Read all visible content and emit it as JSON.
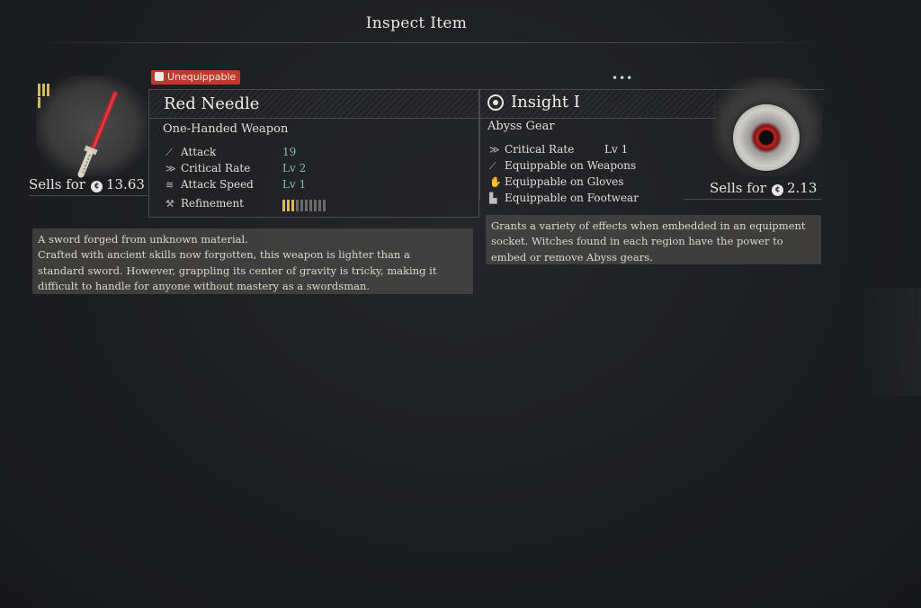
{
  "header": {
    "title": "Inspect Item",
    "pager": "•••"
  },
  "left_item": {
    "tag": "Unequippable",
    "name": "Red Needle",
    "type": "One-Handed Weapon",
    "sells_label": "Sells for",
    "sells_value": "13.63",
    "stats": [
      {
        "icon": "attack-icon",
        "label": "Attack",
        "value": "19"
      },
      {
        "icon": "critical-rate-icon",
        "label": "Critical Rate",
        "value": "Lv 2"
      },
      {
        "icon": "attack-speed-icon",
        "label": "Attack Speed",
        "value": "Lv 1"
      },
      {
        "icon": "refinement-icon",
        "label": "Refinement",
        "value": ""
      }
    ],
    "refinement": {
      "level": 3,
      "max": 10
    },
    "description": [
      "A sword forged from unknown material.",
      "Crafted with ancient skills now forgotten, this weapon is lighter than a",
      "standard sword. However, grappling its center of gravity is tricky, making it",
      "difficult to handle for anyone without mastery as a swordsman."
    ]
  },
  "right_item": {
    "name": "Insight I",
    "type": "Abyss Gear",
    "sells_label": "Sells for",
    "sells_value": "2.13",
    "stats": [
      {
        "icon": "critical-rate-icon",
        "label": "Critical Rate",
        "value": "Lv 1"
      },
      {
        "icon": "weapons-icon",
        "label": "Equippable on Weapons",
        "value": ""
      },
      {
        "icon": "gloves-icon",
        "label": "Equippable on Gloves",
        "value": ""
      },
      {
        "icon": "footwear-icon",
        "label": "Equippable on Footwear",
        "value": ""
      }
    ],
    "description": [
      "Grants a variety of effects when embedded in an equipment",
      "socket. Witches found in each region have the power to",
      "embed or remove Abyss gears."
    ]
  },
  "colors": {
    "accent_stat": "#7fc1a2",
    "tag_red": "#c0392b",
    "rarity_gold": "#d6b85a"
  }
}
